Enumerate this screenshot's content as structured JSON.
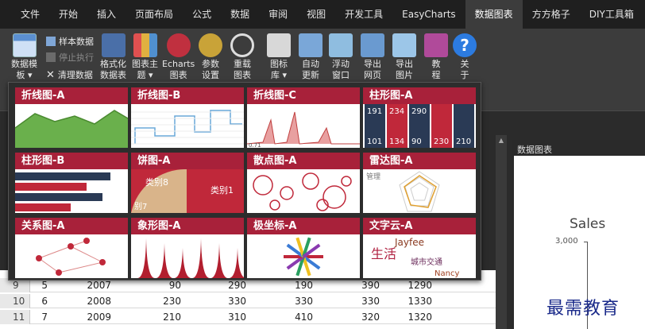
{
  "ribbon_tabs": [
    "文件",
    "开始",
    "插入",
    "页面布局",
    "公式",
    "数据",
    "审阅",
    "视图",
    "开发工具",
    "EasyCharts",
    "数据图表",
    "方方格子",
    "DIY工具箱"
  ],
  "ribbon": {
    "template_btn": {
      "line1": "数据模",
      "line2": "板 ▾"
    },
    "sample_data": "样本数据",
    "stop_exec": "停止执行",
    "clear_data": "清理数据",
    "format_btn": {
      "line1": "格式化",
      "line2": "数据表"
    },
    "theme_btn": {
      "line1": "图表主",
      "line2": "题 ▾"
    },
    "echarts_btn": {
      "line1": "Echarts",
      "line2": "图表"
    },
    "params_btn": {
      "line1": "参数",
      "line2": "设置"
    },
    "reload_btn": {
      "line1": "重载",
      "line2": "图表"
    },
    "library_btn": {
      "line1": "图标",
      "line2": "库 ▾"
    },
    "autoupdate_btn": {
      "line1": "自动",
      "line2": "更新"
    },
    "float_btn": {
      "line1": "浮动",
      "line2": "窗口"
    },
    "export_web_btn": {
      "line1": "导出",
      "line2": "网页"
    },
    "export_img_btn": {
      "line1": "导出",
      "line2": "图片"
    },
    "tutorial_btn": {
      "line1": "教",
      "line2": "程"
    },
    "about_btn": {
      "line1": "关",
      "line2": "于"
    }
  },
  "gallery": {
    "items": [
      {
        "label": "折线图-A",
        "kind": "line-area"
      },
      {
        "label": "折线图-B",
        "kind": "line-step"
      },
      {
        "label": "折线图-C",
        "kind": "line-spike"
      },
      {
        "label": "柱形图-A",
        "kind": "bar-labeled"
      },
      {
        "label": "柱形图-B",
        "kind": "bar-horizontal"
      },
      {
        "label": "饼图-A",
        "kind": "pie"
      },
      {
        "label": "散点图-A",
        "kind": "scatter"
      },
      {
        "label": "雷达图-A",
        "kind": "radar"
      },
      {
        "label": "关系图-A",
        "kind": "graph"
      },
      {
        "label": "象形图-A",
        "kind": "pictorial"
      },
      {
        "label": "极坐标-A",
        "kind": "polar"
      },
      {
        "label": "文字云-A",
        "kind": "wordcloud"
      }
    ],
    "preview_text": {
      "line_c_left": "0.71",
      "bar_a_top": [
        "191",
        "234",
        "290"
      ],
      "bar_a_bottom": [
        "101",
        "134",
        "90",
        "230",
        "210"
      ],
      "pie_1": "类别8",
      "pie_2": "类别1",
      "pie_3": "别7",
      "radar_label": "管理",
      "cloud_words": [
        "Jayfee",
        "生活",
        "城市交通",
        "Nancy"
      ]
    }
  },
  "right_pane": {
    "title": "数据图表",
    "chart_title": "Sales",
    "y_tick": "3,000"
  },
  "grid_rows": [
    {
      "row": "9",
      "cells": [
        "5",
        "2007",
        "90",
        "290",
        "190",
        "390",
        "1290"
      ]
    },
    {
      "row": "10",
      "cells": [
        "6",
        "2008",
        "230",
        "330",
        "330",
        "330",
        "1330"
      ]
    },
    {
      "row": "11",
      "cells": [
        "7",
        "2009",
        "210",
        "310",
        "410",
        "320",
        "1320"
      ]
    }
  ],
  "watermark": "最需教育",
  "colors": {
    "accent": "#a8213a",
    "ribbon": "#3c3c3c",
    "tabbar": "#1f1f1f"
  }
}
